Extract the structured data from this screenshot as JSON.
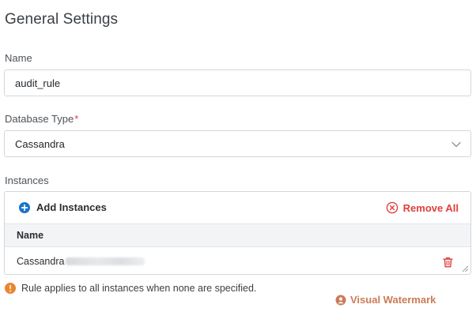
{
  "section": {
    "title": "General Settings"
  },
  "name_field": {
    "label": "Name",
    "value": "audit_rule"
  },
  "db_type": {
    "label": "Database Type",
    "required_mark": "*",
    "value": "Cassandra"
  },
  "instances": {
    "label": "Instances",
    "add_label": "Add Instances",
    "remove_all_label": "Remove All",
    "column_header": "Name",
    "rows": [
      {
        "name_prefix": "Cassandra"
      }
    ]
  },
  "note": {
    "text": "Rule applies to all instances when none are specified."
  },
  "watermark": {
    "text": "Visual Watermark"
  },
  "colors": {
    "accent_blue": "#1a73c9",
    "danger": "#e0403b",
    "warning": "#e9862f"
  },
  "icons": {
    "add": "plus-circle-icon",
    "remove_all": "x-circle-icon",
    "select": "chevron-down-icon",
    "row_delete": "trash-icon",
    "note": "info-icon"
  }
}
